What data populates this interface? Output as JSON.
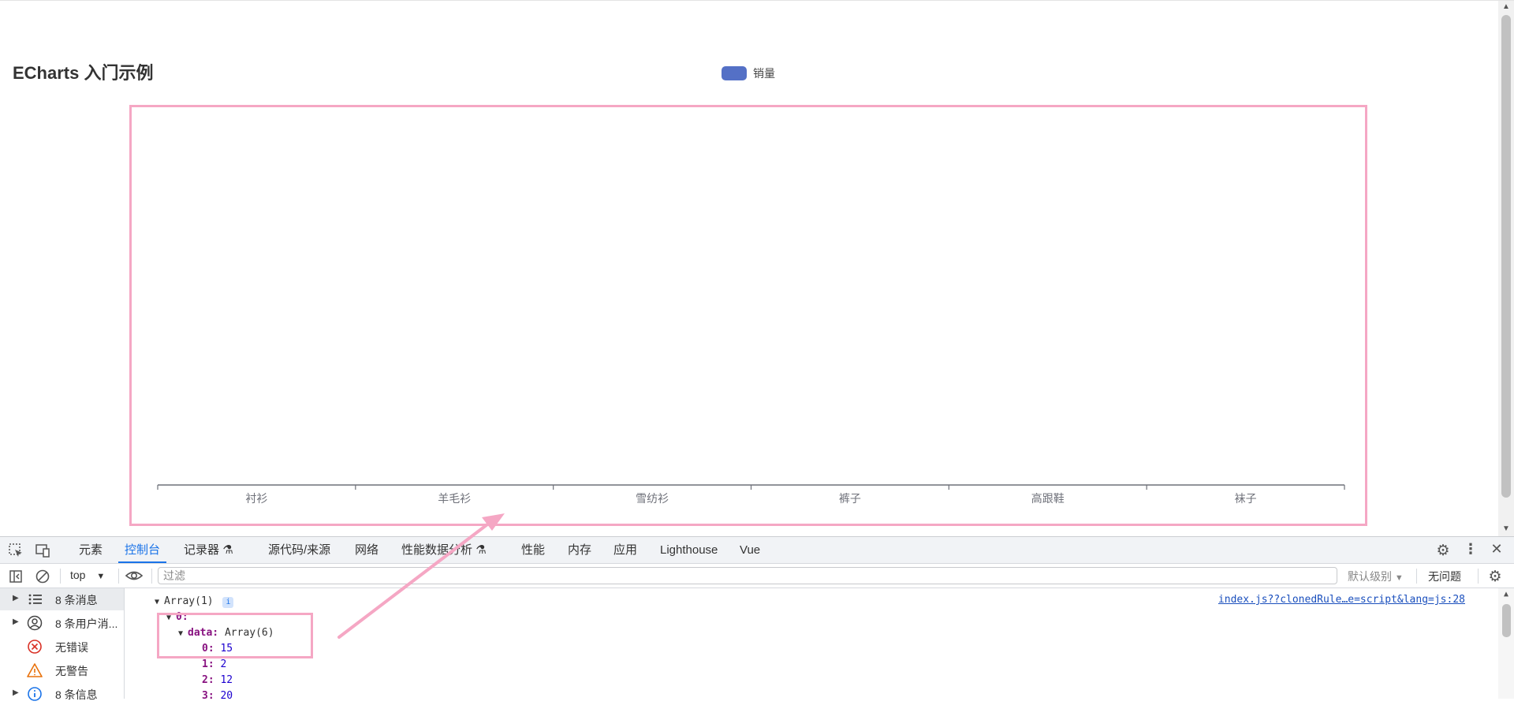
{
  "page": {
    "title": "ECharts 入门示例"
  },
  "chart_data": {
    "type": "bar",
    "title": "",
    "legend": [
      "销量"
    ],
    "legend_position": "top-center",
    "categories": [
      "衬衫",
      "羊毛衫",
      "雪纺衫",
      "裤子",
      "高跟鞋",
      "袜子"
    ],
    "series": [
      {
        "name": "销量",
        "values": []
      }
    ],
    "colors": {
      "series": "#5470c6",
      "axis": "#6e7079",
      "frame": "#f5a7c4"
    },
    "grid": false
  },
  "devtools": {
    "tabs": [
      {
        "label": "元素",
        "active": false
      },
      {
        "label": "控制台",
        "active": true
      },
      {
        "label": "记录器",
        "active": false
      },
      {
        "label": "源代码/来源",
        "active": false
      },
      {
        "label": "网络",
        "active": false
      },
      {
        "label": "性能数据分析",
        "active": false
      },
      {
        "label": "性能",
        "active": false
      },
      {
        "label": "内存",
        "active": false
      },
      {
        "label": "应用",
        "active": false
      },
      {
        "label": "Lighthouse",
        "active": false
      },
      {
        "label": "Vue",
        "active": false
      }
    ],
    "toolbar": {
      "context": "top",
      "filter_placeholder": "过滤",
      "level": "默认级别",
      "issues": "无问题"
    },
    "sidebar": [
      {
        "label": "8 条消息",
        "icon": "list-icon",
        "selected": true
      },
      {
        "label": "8 条用户消...",
        "icon": "user-icon",
        "selected": false
      },
      {
        "label": "无错误",
        "icon": "error-icon",
        "selected": false
      },
      {
        "label": "无警告",
        "icon": "warning-icon",
        "selected": false
      },
      {
        "label": "8 条信息",
        "icon": "info-icon",
        "selected": false
      }
    ],
    "console": {
      "source": "index.js??clonedRule…e=script&lang=js:28",
      "array_label": "Array(1)",
      "info_badge": "i",
      "item0_key": "0:",
      "data_key": "data:",
      "data_value": "Array(6)",
      "entries": [
        {
          "key": "0:",
          "value": "15"
        },
        {
          "key": "1:",
          "value": "2"
        },
        {
          "key": "2:",
          "value": "12"
        },
        {
          "key": "3:",
          "value": "20"
        }
      ]
    },
    "colors": {
      "accent": "#1a73e8",
      "annotation": "#f5a7c4"
    }
  }
}
